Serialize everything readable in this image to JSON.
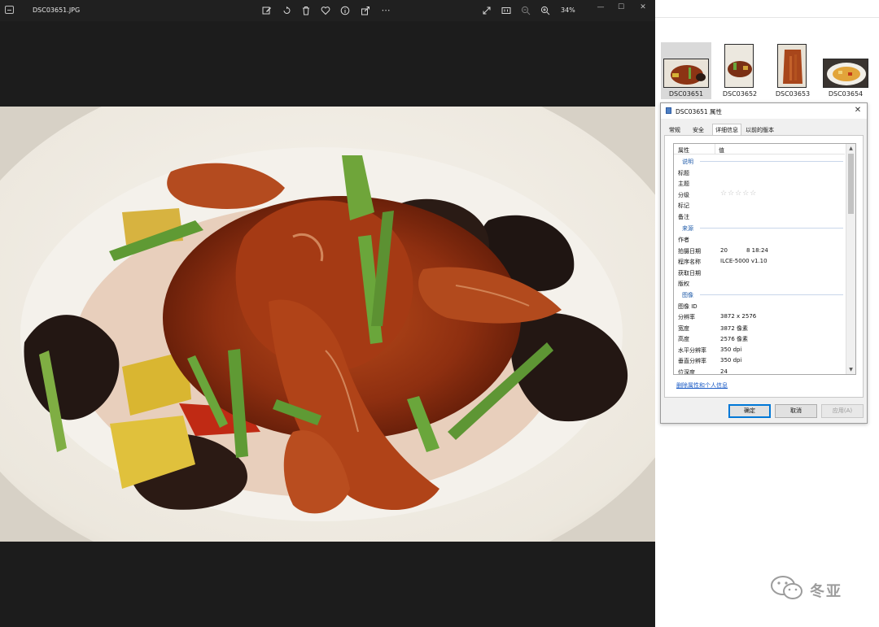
{
  "viewer": {
    "filename": "DSC03651.JPG",
    "zoom": "34%",
    "toolbar_icons": [
      "edit-icon",
      "rotate-icon",
      "delete-icon",
      "favorite-icon",
      "info-icon",
      "share-icon",
      "more-icon"
    ],
    "right_icons": [
      "fullscreen-icon",
      "actual-size-icon",
      "zoom-out-icon",
      "zoom-in-icon"
    ],
    "window_controls": {
      "minimize": "—",
      "maximize": "☐",
      "close": "✕"
    }
  },
  "filmstrip": [
    {
      "caption": "DSC03651",
      "selected": true
    },
    {
      "caption": "DSC03652",
      "selected": false
    },
    {
      "caption": "DSC03653",
      "selected": false
    },
    {
      "caption": "DSC03654",
      "selected": false
    }
  ],
  "dialog": {
    "title": "DSC03651 属性",
    "close": "✕",
    "tabs": [
      {
        "label": "常规",
        "active": false
      },
      {
        "label": "安全",
        "active": false
      },
      {
        "label": "详细信息",
        "active": true
      },
      {
        "label": "以前的版本",
        "active": false
      }
    ],
    "header": {
      "property": "属性",
      "value": "值"
    },
    "groups": {
      "description": {
        "label": "说明",
        "rows": [
          {
            "key": "标题",
            "value": ""
          },
          {
            "key": "主题",
            "value": ""
          },
          {
            "key": "分级",
            "value": "☆☆☆☆☆"
          },
          {
            "key": "标记",
            "value": ""
          },
          {
            "key": "备注",
            "value": ""
          }
        ]
      },
      "origin": {
        "label": "来源",
        "rows": [
          {
            "key": "作者",
            "value": "",
            "value2": ""
          },
          {
            "key": "拍摄日期",
            "value": "20",
            "value2": "8 18:24"
          },
          {
            "key": "程序名称",
            "value": "ILCE-5000 v1.10",
            "value2": ""
          },
          {
            "key": "获取日期",
            "value": "",
            "value2": ""
          },
          {
            "key": "版权",
            "value": "",
            "value2": ""
          }
        ]
      },
      "image": {
        "label": "图像",
        "rows": [
          {
            "key": "图像 ID",
            "value": ""
          },
          {
            "key": "分辨率",
            "value": "3872 x 2576"
          },
          {
            "key": "宽度",
            "value": "3872 像素"
          },
          {
            "key": "高度",
            "value": "2576 像素"
          },
          {
            "key": "水平分辨率",
            "value": "350 dpi"
          },
          {
            "key": "垂直分辨率",
            "value": "350 dpi"
          },
          {
            "key": "位深度",
            "value": "24"
          }
        ]
      }
    },
    "remove_link": "删除属性和个人信息",
    "buttons": {
      "ok": "确定",
      "cancel": "取消",
      "apply": "应用(A)"
    }
  },
  "watermark": {
    "text": "冬亚"
  }
}
